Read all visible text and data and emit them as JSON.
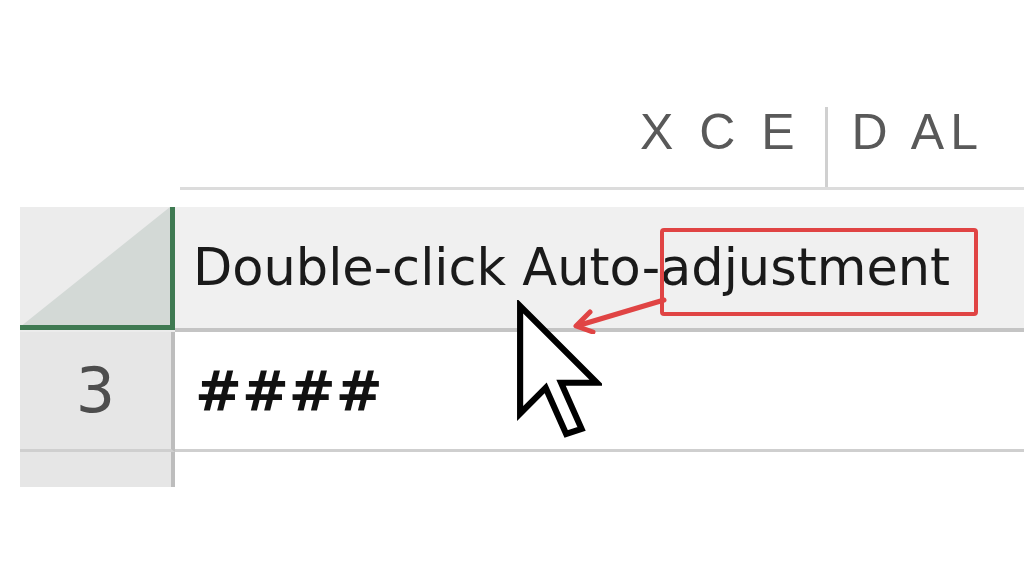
{
  "app_title": {
    "left": "X C E",
    "right": "D AL"
  },
  "column_header": {
    "label": "Double-click Auto-adjustment",
    "highlighted": true
  },
  "rows": [
    {
      "number": "3",
      "value": "####"
    }
  ]
}
